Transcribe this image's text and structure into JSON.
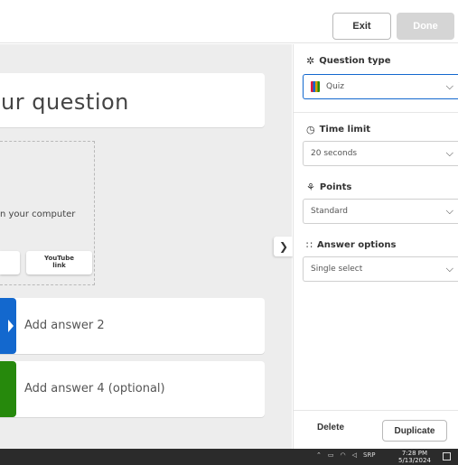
{
  "toolbar": {
    "exit_label": "Exit",
    "done_label": "Done"
  },
  "editor": {
    "question_placeholder": "ur question",
    "media_hint": "n your computer",
    "youtube_label_1": "YouTube",
    "youtube_label_2": "link",
    "answers": [
      {
        "label": "Add answer 2",
        "color": "#1368ce"
      },
      {
        "label": "Add answer 4 (optional)",
        "color": "#26890c"
      }
    ],
    "collapse_icon": "chevron-right"
  },
  "sidebar": {
    "question_type": {
      "title": "Question type",
      "icon": "shapes-icon",
      "value": "Quiz"
    },
    "time_limit": {
      "title": "Time limit",
      "icon": "clock-icon",
      "value": "20 seconds"
    },
    "points": {
      "title": "Points",
      "icon": "medal-icon",
      "value": "Standard"
    },
    "answer_options": {
      "title": "Answer options",
      "icon": "dots-grid-icon",
      "value": "Single select"
    },
    "delete_label": "Delete",
    "duplicate_label": "Duplicate"
  },
  "taskbar": {
    "lang": "SRP",
    "time": "7:28 PM",
    "date": "5/13/2024"
  },
  "colors": {
    "accent": "#1368ce",
    "green": "#26890c",
    "canvas": "#ededed"
  }
}
